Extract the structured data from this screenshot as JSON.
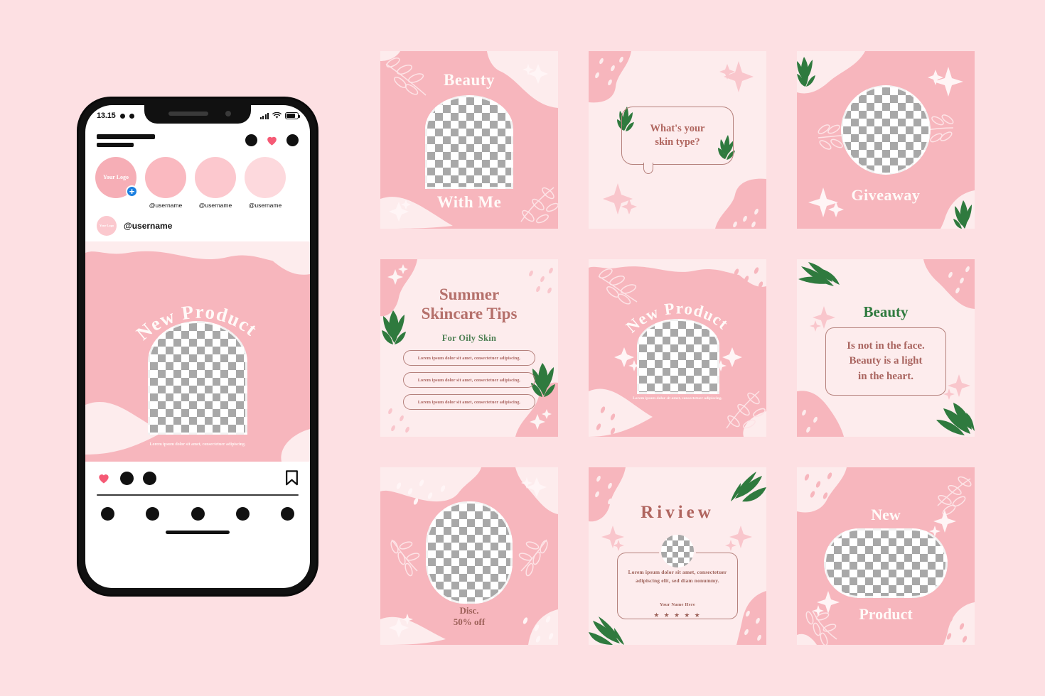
{
  "palette": {
    "page_bg": "#fde0e3",
    "card_pink": "#f7b6bd",
    "card_light": "#fdeced",
    "rose_text": "#b5706b",
    "rose_dark": "#a9645f",
    "green": "#2f7a3e",
    "white_text": "#fffaf8",
    "heart_red": "#f55a75",
    "badge_blue": "#1b7fe0"
  },
  "phone": {
    "status": {
      "time": "13.15",
      "signal_icon": "signal-bars-icon",
      "wifi_icon": "wifi-icon",
      "battery_icon": "battery-icon"
    },
    "header": {
      "logo_icon": "logo-placeholder-icon",
      "messenger_icon": "messenger-icon",
      "heart_icon": "heart-icon",
      "add_icon": "add-post-icon"
    },
    "stories": [
      {
        "label": "Your Logo",
        "username": "",
        "has_add_badge": true,
        "badge": "+"
      },
      {
        "label": "",
        "username": "@username",
        "has_add_badge": false
      },
      {
        "label": "",
        "username": "@username",
        "has_add_badge": false
      },
      {
        "label": "",
        "username": "@username",
        "has_add_badge": false
      }
    ],
    "post": {
      "avatar_label": "Your Logo",
      "username": "@username",
      "title": "New Product",
      "caption": "Lorem ipsum dolor sit amet, consectetuer adipiscing.",
      "actions": {
        "like_icon": "heart-icon",
        "comment_icon": "comment-icon",
        "share_icon": "share-icon",
        "save_icon": "bookmark-icon"
      }
    },
    "tabbar": {
      "home_icon": "home-icon",
      "search_icon": "search-icon",
      "reels_icon": "reels-icon",
      "shop_icon": "shop-icon",
      "profile_icon": "profile-icon"
    }
  },
  "grid": {
    "cards": [
      {
        "id": "beauty-with-me",
        "theme": "pink",
        "title_top": "Beauty",
        "title_bottom": "With Me",
        "placeholder": "arch-image-placeholder",
        "decor": [
          "leaf-outline-icon",
          "sparkle-icon",
          "blob-shape"
        ]
      },
      {
        "id": "skin-type-question",
        "theme": "light",
        "bubble_text": "What's your\nskin type?",
        "bubble_line1": "What's your",
        "bubble_line2": "skin type?",
        "decor": [
          "green-leaf-icon",
          "sparkle-icon",
          "blob-shape",
          "speech-bubble"
        ]
      },
      {
        "id": "giveaway",
        "theme": "pink",
        "title_bottom": "Giveaway",
        "placeholder": "circle-image-placeholder",
        "decor": [
          "green-leaf-icon",
          "leaf-outline-icon",
          "sparkle-icon",
          "blob-shape"
        ]
      },
      {
        "id": "summer-skincare-tips",
        "theme": "light",
        "title_line1": "Summer",
        "title_line2": "Skincare Tips",
        "subtitle": "For Oily Skin",
        "tips": [
          "Lorem ipsum dolor sit amet, consectetuer adipiscing.",
          "Lorem ipsum dolor sit amet, consectetuer adipiscing.",
          "Lorem ipsum dolor sit amet, consectetuer adipiscing."
        ],
        "decor": [
          "green-leaf-icon",
          "sparkle-icon",
          "blob-shape",
          "dots-pattern"
        ]
      },
      {
        "id": "new-product-arch",
        "theme": "pink",
        "arc_title": "New Product",
        "caption": "Lorem ipsum dolor sit amet, consectetuer adipiscing.",
        "placeholder": "arch-image-placeholder",
        "decor": [
          "leaf-outline-icon",
          "sparkle-icon",
          "blob-shape",
          "dots-pattern"
        ]
      },
      {
        "id": "beauty-quote",
        "theme": "light",
        "title": "Beauty",
        "quote_line1": "Is not in the face.",
        "quote_line2": "Beauty is a light",
        "quote_line3": "in the heart.",
        "decor": [
          "green-leaf-icon",
          "sparkle-icon",
          "blob-shape",
          "dots-pattern"
        ]
      },
      {
        "id": "discount-50",
        "theme": "pink",
        "label_line1": "Disc.",
        "label_line2": "50% off",
        "placeholder": "oval-image-placeholder",
        "decor": [
          "leaf-outline-icon",
          "sparkle-icon",
          "blob-shape",
          "dots-pattern"
        ]
      },
      {
        "id": "review",
        "theme": "light",
        "title": "Riview",
        "review_text": "Lorem ipsum dolor sit amet, consectetuer adipiscing elit, sed diam nonummy.",
        "reviewer_name": "Your Name Here",
        "rating": "★ ★ ★ ★ ★",
        "rating_value": 5,
        "placeholder": "circle-avatar-placeholder",
        "decor": [
          "green-leaf-icon",
          "sparkle-icon",
          "blob-shape",
          "dots-pattern"
        ]
      },
      {
        "id": "new-product-pill",
        "theme": "pink",
        "title_top": "New",
        "title_bottom": "Product",
        "placeholder": "pill-image-placeholder",
        "decor": [
          "leaf-outline-icon",
          "sparkle-icon",
          "blob-shape",
          "dots-pattern"
        ]
      }
    ]
  }
}
